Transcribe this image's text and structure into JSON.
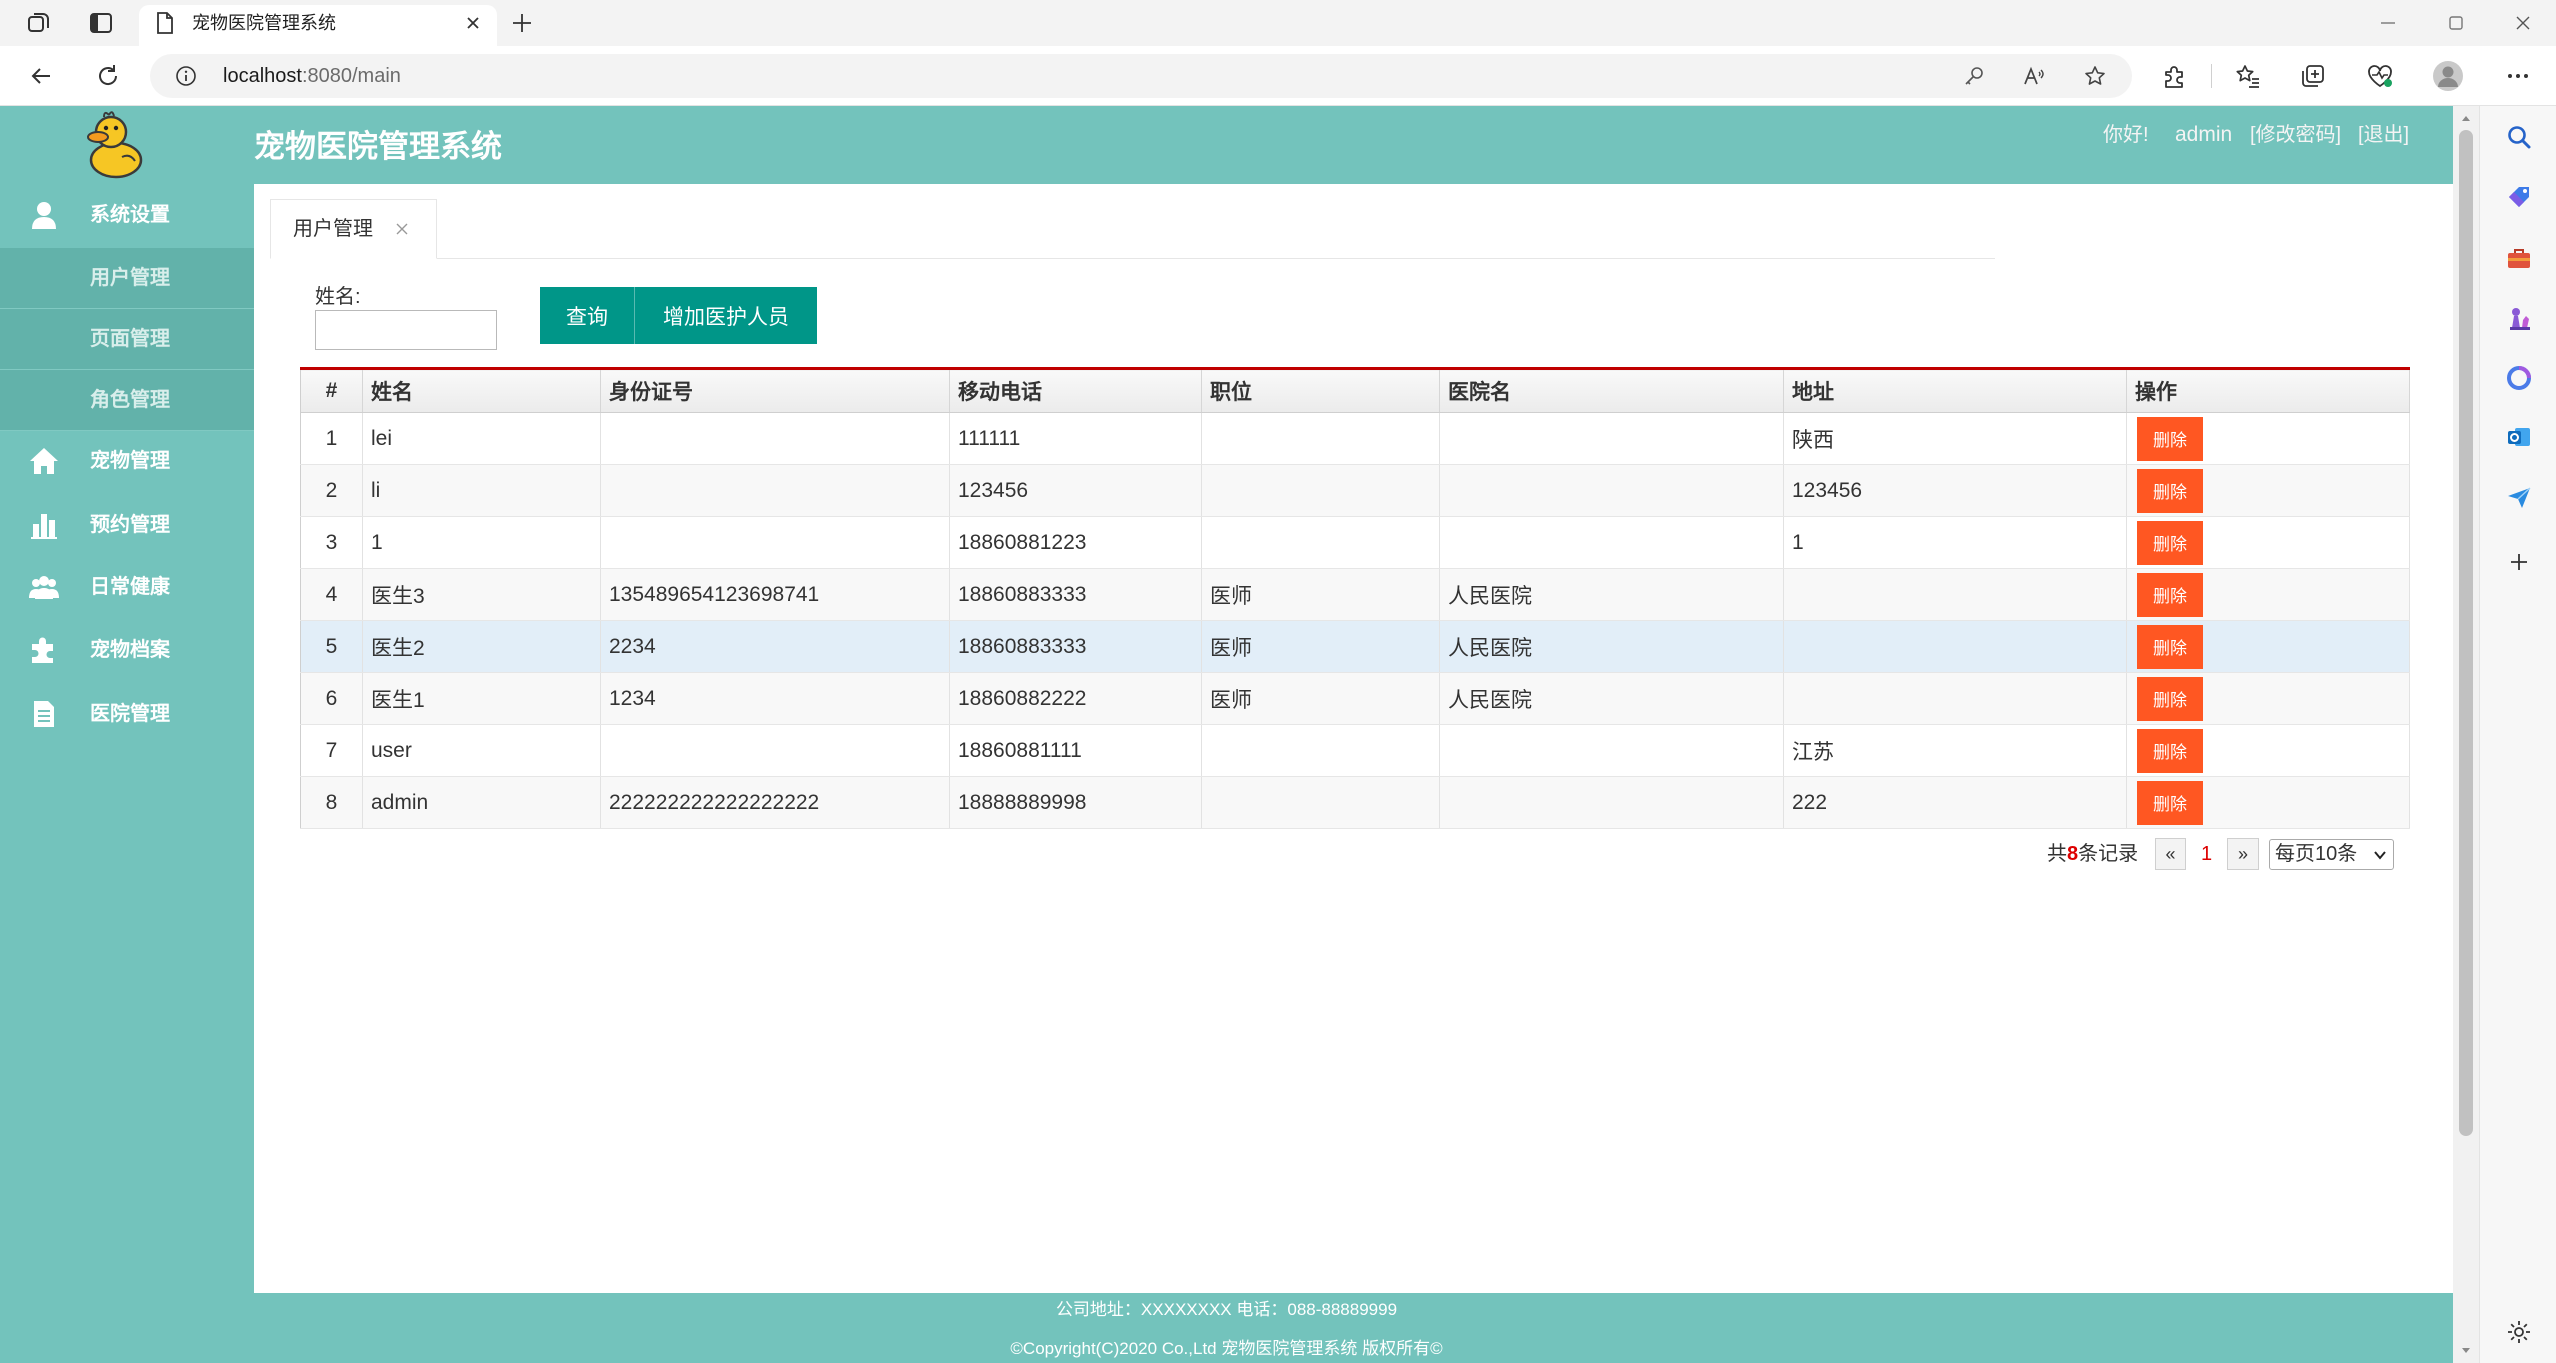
{
  "browser": {
    "tab_title": "宠物医院管理系统",
    "url_host": "localhost",
    "url_rest": ":8080/main"
  },
  "theme": {
    "primary": "#73c3bc",
    "button": "#009688",
    "danger": "#ff5722",
    "table_top_border": "#c00000",
    "hover_row": "#e2eef8"
  },
  "app": {
    "title": "宠物医院管理系统"
  },
  "header": {
    "greeting": "你好!",
    "username": "admin",
    "change_password": "[修改密码]",
    "logout": "[退出]"
  },
  "sidebar": {
    "menu": [
      {
        "label": "系统设置",
        "icon": "user-icon",
        "expanded": true,
        "children": [
          "用户管理",
          "页面管理",
          "角色管理"
        ]
      },
      {
        "label": "宠物管理",
        "icon": "home-icon"
      },
      {
        "label": "预约管理",
        "icon": "bar-chart-icon"
      },
      {
        "label": "日常健康",
        "icon": "group-icon"
      },
      {
        "label": "宠物档案",
        "icon": "puzzle-icon"
      },
      {
        "label": "医院管理",
        "icon": "document-icon"
      }
    ]
  },
  "tabs": [
    {
      "label": "用户管理",
      "active": true
    }
  ],
  "search": {
    "name_label": "姓名:",
    "name_value": "",
    "query_button": "查询",
    "add_button": "增加医护人员"
  },
  "table": {
    "columns": [
      "#",
      "姓名",
      "身份证号",
      "移动电话",
      "职位",
      "医院名",
      "地址",
      "操作"
    ],
    "delete_label": "删除",
    "rows": [
      {
        "no": "1",
        "name": "lei",
        "id_card": "",
        "phone": "111111",
        "position": "",
        "hospital": "",
        "address": "陕西"
      },
      {
        "no": "2",
        "name": "li",
        "id_card": "",
        "phone": "123456",
        "position": "",
        "hospital": "",
        "address": "123456"
      },
      {
        "no": "3",
        "name": "1",
        "id_card": "",
        "phone": "18860881223",
        "position": "",
        "hospital": "",
        "address": "1"
      },
      {
        "no": "4",
        "name": "医生3",
        "id_card": "135489654123698741",
        "phone": "18860883333",
        "position": "医师",
        "hospital": "人民医院",
        "address": ""
      },
      {
        "no": "5",
        "name": "医生2",
        "id_card": "2234",
        "phone": "18860883333",
        "position": "医师",
        "hospital": "人民医院",
        "address": ""
      },
      {
        "no": "6",
        "name": "医生1",
        "id_card": "1234",
        "phone": "18860882222",
        "position": "医师",
        "hospital": "人民医院",
        "address": ""
      },
      {
        "no": "7",
        "name": "user",
        "id_card": "",
        "phone": "18860881111",
        "position": "",
        "hospital": "",
        "address": "江苏"
      },
      {
        "no": "8",
        "name": "admin",
        "id_card": "222222222222222222",
        "phone": "18888889998",
        "position": "",
        "hospital": "",
        "address": "222"
      }
    ]
  },
  "pagination": {
    "prefix": "共",
    "total": "8",
    "suffix": "条记录",
    "prev": "«",
    "current": "1",
    "next": "»",
    "page_size": "每页10条"
  },
  "footer": {
    "line1": "公司地址：XXXXXXXX 电话：088-88889999",
    "line2": "©Copyright(C)2020 Co.,Ltd 宠物医院管理系统 版权所有©"
  }
}
